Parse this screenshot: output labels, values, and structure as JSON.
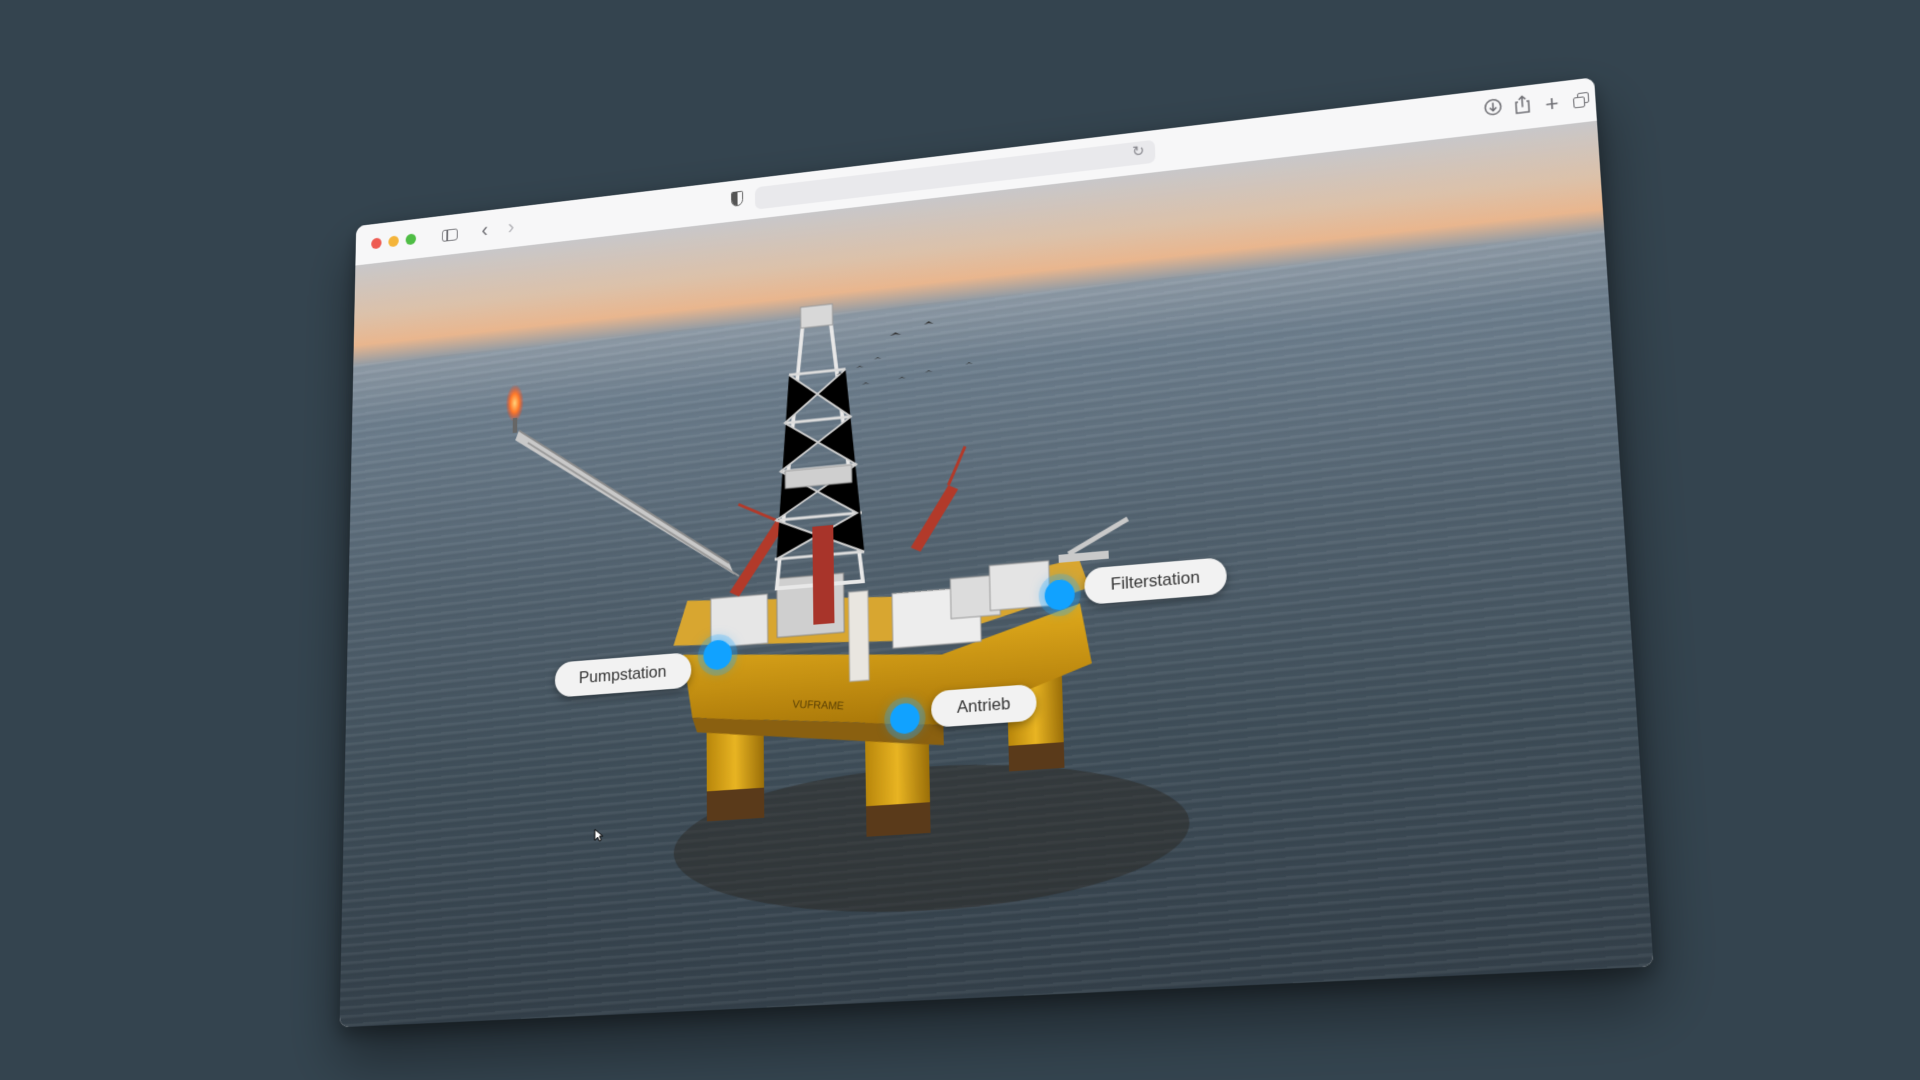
{
  "page": {
    "background_color": "#34444f"
  },
  "browser": {
    "url": "",
    "icons": [
      "close-button",
      "minimize-button",
      "maximize-button",
      "sidebar-icon",
      "back-arrow-icon",
      "forward-arrow-icon",
      "shield-icon",
      "reload-icon",
      "download-icon",
      "share-icon",
      "new-tab-icon",
      "tab-overview-icon"
    ]
  },
  "scene": {
    "platform_text": "VUFRAME",
    "hotspots": [
      {
        "label": "Pumpstation",
        "color": "#11a2ff"
      },
      {
        "label": "Filterstation",
        "color": "#11a2ff"
      },
      {
        "label": "Antrieb",
        "color": "#11a2ff"
      }
    ]
  }
}
